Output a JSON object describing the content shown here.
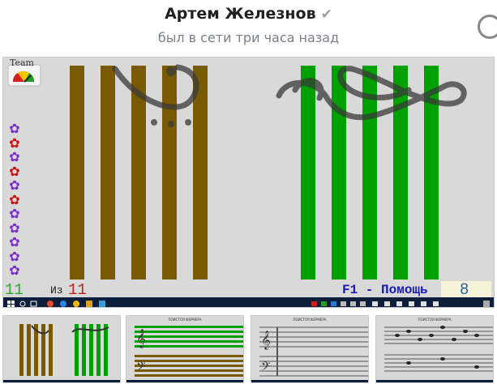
{
  "header": {
    "name": "Артем Железнов",
    "verified_icon": "check-icon",
    "status": "был в сети три часа назад"
  },
  "game": {
    "team_label": "Team",
    "gauge_icon": "gauge-icon",
    "score": "11",
    "of_label": "Из",
    "total": "11",
    "help_label": "F1 - Помощь",
    "level": "8",
    "left_bar_color": "#7a5a00",
    "right_bar_color": "#00a000",
    "flower_colors": [
      "#7a2ec8",
      "#cc1111",
      "#7a2ec8",
      "#cc1111",
      "#7a2ec8",
      "#cc1111",
      "#7a2ec8",
      "#7a2ec8",
      "#7a2ec8",
      "#7a2ec8",
      "#7a2ec8"
    ]
  },
  "thumbnails": [
    {
      "title": ""
    },
    {
      "title": "ПОИСТОЯ ФЕРМЕРА"
    },
    {
      "title": "ПОИСТОЯ ФЕРМЕРА"
    },
    {
      "title": "ПОИСТОЯ ФЕРМЕРА"
    }
  ]
}
